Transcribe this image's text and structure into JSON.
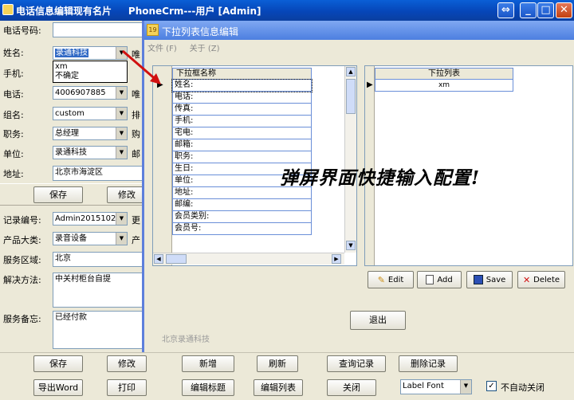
{
  "window": {
    "title": "电话信息编辑现有名片",
    "app_title": "PhoneCrm---用户 [Admin]"
  },
  "form": {
    "phone_label": "电话号码:",
    "phone_value": "",
    "name_label": "姓名:",
    "name_value": "录通科技",
    "name_suffix": "唯",
    "mobile_label": "手机:",
    "dropdown_options": [
      "xm",
      "不确定"
    ],
    "tel_label": "电话:",
    "tel_value": "4006907885",
    "tel_suffix": "唯",
    "group_label": "组名:",
    "group_value": "custom",
    "group_suffix": "排",
    "job_label": "职务:",
    "job_value": "总经理",
    "job_suffix": "购",
    "company_label": "单位:",
    "company_value": "录通科技",
    "company_suffix": "邮",
    "address_label": "地址:",
    "address_value": "北京市海淀区",
    "save_top": "保存",
    "edit_top": "修改",
    "record_label": "记录编号:",
    "record_value": "Admin20151027",
    "record_suffix": "更",
    "category_label": "产品大类:",
    "category_value": "录音设备",
    "category_suffix": "产",
    "region_label": "服务区域:",
    "region_value": "北京",
    "solution_label": "解决方法:",
    "solution_value": "中关村柜台自提",
    "note_label": "服务备忘:",
    "note_value": "已经付款"
  },
  "dialog": {
    "title": "下拉列表信息编辑",
    "menu": [
      "文件 (F)",
      "关于 (Z)"
    ],
    "left_header": "下拉框名称",
    "left_rows": [
      "姓名:",
      "电话:",
      "传真:",
      "手机:",
      "宅电:",
      "邮箱:",
      "职务:",
      "生日:",
      "单位:",
      "地址:",
      "邮编:",
      "会员类别:",
      "会员号:"
    ],
    "right_header": "下拉列表",
    "right_rows": [
      "xm"
    ],
    "overlay_text": "弹屏界面快捷输入配置!",
    "btn_edit": "Edit",
    "btn_add": "Add",
    "btn_save": "Save",
    "btn_delete": "Delete",
    "btn_exit": "退出",
    "company": "北京录通科技"
  },
  "toolbar": {
    "row1": [
      "保存",
      "修改",
      "新增",
      "刷新",
      "查询记录",
      "删除记录"
    ],
    "row2": [
      "导出Word",
      "打印",
      "编辑标题",
      "编辑列表",
      "关闭"
    ],
    "font_select": "Label Font",
    "checkbox_label": "不自动关闭",
    "checkbox_checked": true
  },
  "colors": {
    "titlebar": "#0a50c8",
    "dialog_title": "#6a96ea",
    "overlay": "#000000",
    "arrow": "#d01010"
  }
}
